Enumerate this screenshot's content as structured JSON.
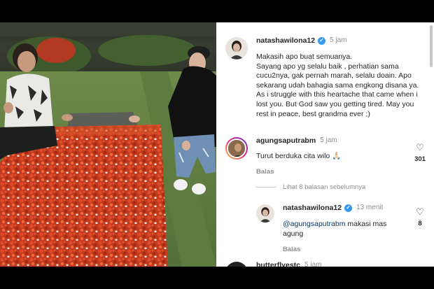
{
  "comments": [
    {
      "username": "natashawilona12",
      "verified": true,
      "time": "5 jam",
      "text": "Makasih apo buat semuanya.\nSayang apo yg selalu baik , perhatian sama cucu2nya, gak pernah marah, selalu doain. Apo sekarang udah bahagia sama engkong disana ya. As i struggle with this heartache that came when i lost you. But God saw you getting tired. May you rest in peace, best grandma ever ;)"
    },
    {
      "username": "agungsaputrabm",
      "verified": false,
      "time": "5 jam",
      "text": "Turut berduka cita wilo 🙏🏻",
      "reply_label": "Balas",
      "likes": "301"
    }
  ],
  "view_replies": "Lihat 8 balasan sebelumnya",
  "reply": {
    "username": "natashawilona12",
    "verified": true,
    "time": "13 menit",
    "mention": "@agungsaputrabm",
    "text": " makasi mas agung",
    "reply_label": "Balas",
    "likes": "8"
  },
  "next_comment": {
    "username": "butterflyestc",
    "time": "5 jam"
  },
  "icons": {
    "verified": "verified-badge-icon",
    "like": "heart-outline-icon"
  },
  "colors": {
    "link": "#00376b",
    "verified": "#3897f0",
    "muted": "#8e8e8e"
  }
}
